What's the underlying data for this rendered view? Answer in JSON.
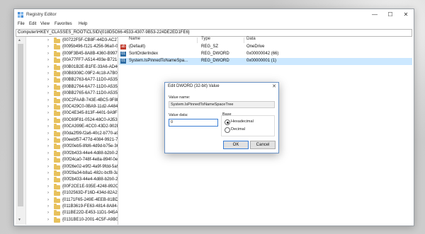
{
  "window": {
    "title": "Registry Editor",
    "icon": "registry-editor-icon"
  },
  "controls": {
    "minimize": "—",
    "maximize": "☐",
    "close": "✕"
  },
  "menu": [
    "File",
    "Edit",
    "View",
    "Favorites",
    "Help"
  ],
  "address": "Computer\\HKEY_CLASSES_ROOT\\CLSID\\{018D5C66-4533-4307-9B53-224DE2ED1FE6}",
  "tree": {
    "items": [
      "{00722F5F-CB8F-44D3-AC27-CC1",
      "{0095b496-f121-4256-96a0-09179",
      "{009F3B45-8A8B-4360-B997-B2AC",
      "{00A77FF7-A514-493e-B721-CDF1",
      "{00B01B2E-B1FE-33A6-AD40-57D",
      "{00B8308C-09F2-4c18-A7B0-4594",
      "{00BB2763-6A77-11D0-A535-00C0",
      "{00BB2764-6A77-11D0-A535-00C0",
      "{00BB2765-6A77-11D0-A535-00C0",
      "{00C2FAAB-743E-4BC5-9F8E-813E",
      "{00C429C0-0BA9-11d2-A484-00C",
      "{00C4E345-813F-4401-9A9F-29F7.",
      "{00C69F81-0524-48C0-A353-4DD9",
      "{00CA399E-4CC0-43D2-902B-CE4",
      "{00da2f99-f2a6-40c2-b770-a920f8",
      "{00eebf57-477d-4084-9921-7ab3c",
      "{00f20eb5-8fd6-4d9d-b75e-36801",
      "{00f2b433-44e4-4d88-b2b0-2698a",
      "{00f24ca0-748f-4e8a-894f-0e0357",
      "{00f26e02-e9f2-4a9f-9fdd-5a962f",
      "{00f29a34-b8a1-482c-bcf8-3ac7b",
      "{00f2b433-44e4-4d88-b2b0-2698a",
      "{00F2CE1E-935E-4248-892C-130F",
      "{0102563D-F16D-434d-82A2-3796",
      "{01171F65-249E-4EEB-81BD-03E1",
      "{011B3619-FE63-4814-8A84-15A1",
      "{011BE22D-E453-11D1-945A-00C0",
      "{0131BE10-2001-4C5F-A9B0-CC8"
    ]
  },
  "list": {
    "headers": [
      "Name",
      "Type",
      "Data"
    ],
    "rows": [
      {
        "icon": "string-value-icon",
        "icon_glyph": "ab",
        "name": "(Default)",
        "type": "REG_SZ",
        "data": "OneDrive",
        "selected": false
      },
      {
        "icon": "dword-value-icon",
        "icon_glyph": "01",
        "name": "SortOrderIndex",
        "type": "REG_DWORD",
        "data": "0x00000042 (66)",
        "selected": false
      },
      {
        "icon": "dword-value-icon",
        "icon_glyph": "01",
        "name": "System.IsPinnedToNameSpa...",
        "type": "REG_DWORD",
        "data": "0x00000001 (1)",
        "selected": true
      }
    ]
  },
  "dialog": {
    "title": "Edit DWORD (32-bit) Value",
    "close": "✕",
    "value_name_label": "Value name:",
    "value_name": "System.IsPinnedToNameSpaceTree",
    "value_data_label": "Value data:",
    "value_data": "0",
    "base_label": "Base",
    "base_options": [
      "Hexadecimal",
      "Decimal"
    ],
    "base_selected": "Hexadecimal",
    "ok": "OK",
    "cancel": "Cancel"
  },
  "colors": {
    "accent": "#3c7fd4",
    "selection": "#cce8ff",
    "folder": "#e8c15c"
  }
}
